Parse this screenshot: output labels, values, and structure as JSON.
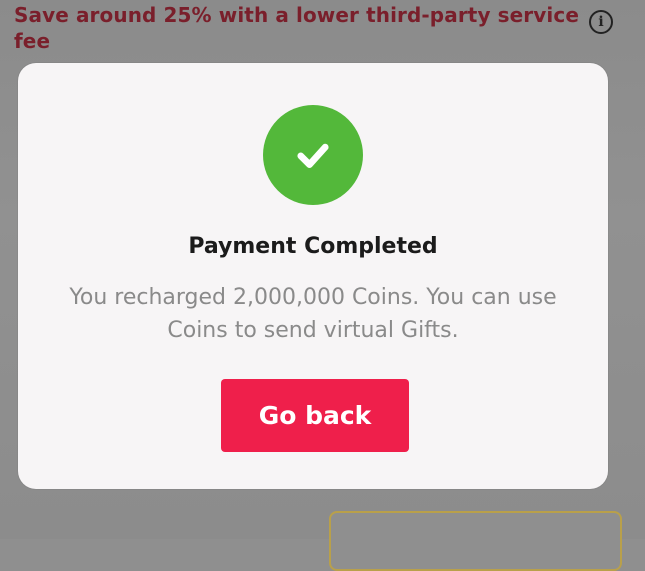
{
  "banner": {
    "text": "Save around 25% with a lower third-party service fee",
    "color": "#7a1f2b"
  },
  "header": {
    "info_icon": "info-icon",
    "info_glyph": "i"
  },
  "dialog": {
    "icon": "checkmark-icon",
    "icon_color": "#53b83a",
    "title": "Payment Completed",
    "message": "You recharged 2,000,000 Coins. You can use Coins to send virtual Gifts.",
    "button_label": "Go back",
    "button_color": "#ef1f4b"
  }
}
